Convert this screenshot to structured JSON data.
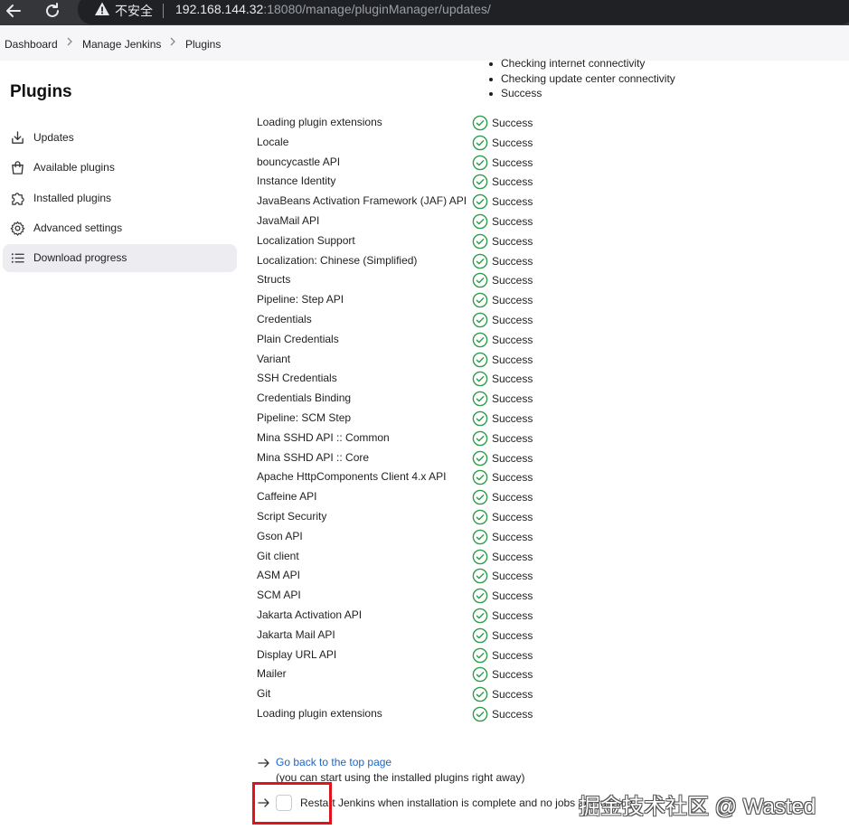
{
  "browser": {
    "insecure_label": "不安全",
    "url_host": "192.168.144.32",
    "url_rest": ":18080/manage/pluginManager/updates/"
  },
  "breadcrumb": {
    "items": [
      "Dashboard",
      "Manage Jenkins",
      "Plugins"
    ],
    "separator": ">"
  },
  "sidebar": {
    "title": "Plugins",
    "items": [
      {
        "label": "Updates",
        "icon": "download-icon"
      },
      {
        "label": "Available plugins",
        "icon": "shopping-bag-icon"
      },
      {
        "label": "Installed plugins",
        "icon": "puzzle-icon"
      },
      {
        "label": "Advanced settings",
        "icon": "gear-icon"
      },
      {
        "label": "Download progress",
        "icon": "list-icon",
        "active": true
      }
    ]
  },
  "connectivity": {
    "items": [
      "Checking internet connectivity",
      "Checking update center connectivity",
      "Success"
    ]
  },
  "plugins": {
    "rows": [
      {
        "name": "Loading plugin extensions",
        "status": "Success"
      },
      {
        "name": "Locale",
        "status": "Success"
      },
      {
        "name": "bouncycastle API",
        "status": "Success"
      },
      {
        "name": "Instance Identity",
        "status": "Success"
      },
      {
        "name": "JavaBeans Activation Framework (JAF) API",
        "status": "Success"
      },
      {
        "name": "JavaMail API",
        "status": "Success"
      },
      {
        "name": "Localization Support",
        "status": "Success"
      },
      {
        "name": "Localization: Chinese (Simplified)",
        "status": "Success"
      },
      {
        "name": "Structs",
        "status": "Success"
      },
      {
        "name": "Pipeline: Step API",
        "status": "Success"
      },
      {
        "name": "Credentials",
        "status": "Success"
      },
      {
        "name": "Plain Credentials",
        "status": "Success"
      },
      {
        "name": "Variant",
        "status": "Success"
      },
      {
        "name": "SSH Credentials",
        "status": "Success"
      },
      {
        "name": "Credentials Binding",
        "status": "Success"
      },
      {
        "name": "Pipeline: SCM Step",
        "status": "Success"
      },
      {
        "name": "Mina SSHD API :: Common",
        "status": "Success"
      },
      {
        "name": "Mina SSHD API :: Core",
        "status": "Success"
      },
      {
        "name": "Apache HttpComponents Client 4.x API",
        "status": "Success"
      },
      {
        "name": "Caffeine API",
        "status": "Success"
      },
      {
        "name": "Script Security",
        "status": "Success"
      },
      {
        "name": "Gson API",
        "status": "Success"
      },
      {
        "name": "Git client",
        "status": "Success"
      },
      {
        "name": "ASM API",
        "status": "Success"
      },
      {
        "name": "SCM API",
        "status": "Success"
      },
      {
        "name": "Jakarta Activation API",
        "status": "Success"
      },
      {
        "name": "Jakarta Mail API",
        "status": "Success"
      },
      {
        "name": "Display URL API",
        "status": "Success"
      },
      {
        "name": "Mailer",
        "status": "Success"
      },
      {
        "name": "Git",
        "status": "Success"
      },
      {
        "name": "Loading plugin extensions",
        "status": "Success"
      }
    ],
    "status_color": "#2e9c4a"
  },
  "actions": {
    "back_link": "Go back to the top page",
    "back_note": "(you can start using the installed plugins right away)",
    "restart_label": "Restart Jenkins when installation is complete and no jobs are running"
  },
  "watermark": "掘金技术社区 @ Wasted",
  "colors": {
    "link": "#1a66c9",
    "highlight": "#e0121c",
    "active_nav_bg": "#ececf1"
  }
}
